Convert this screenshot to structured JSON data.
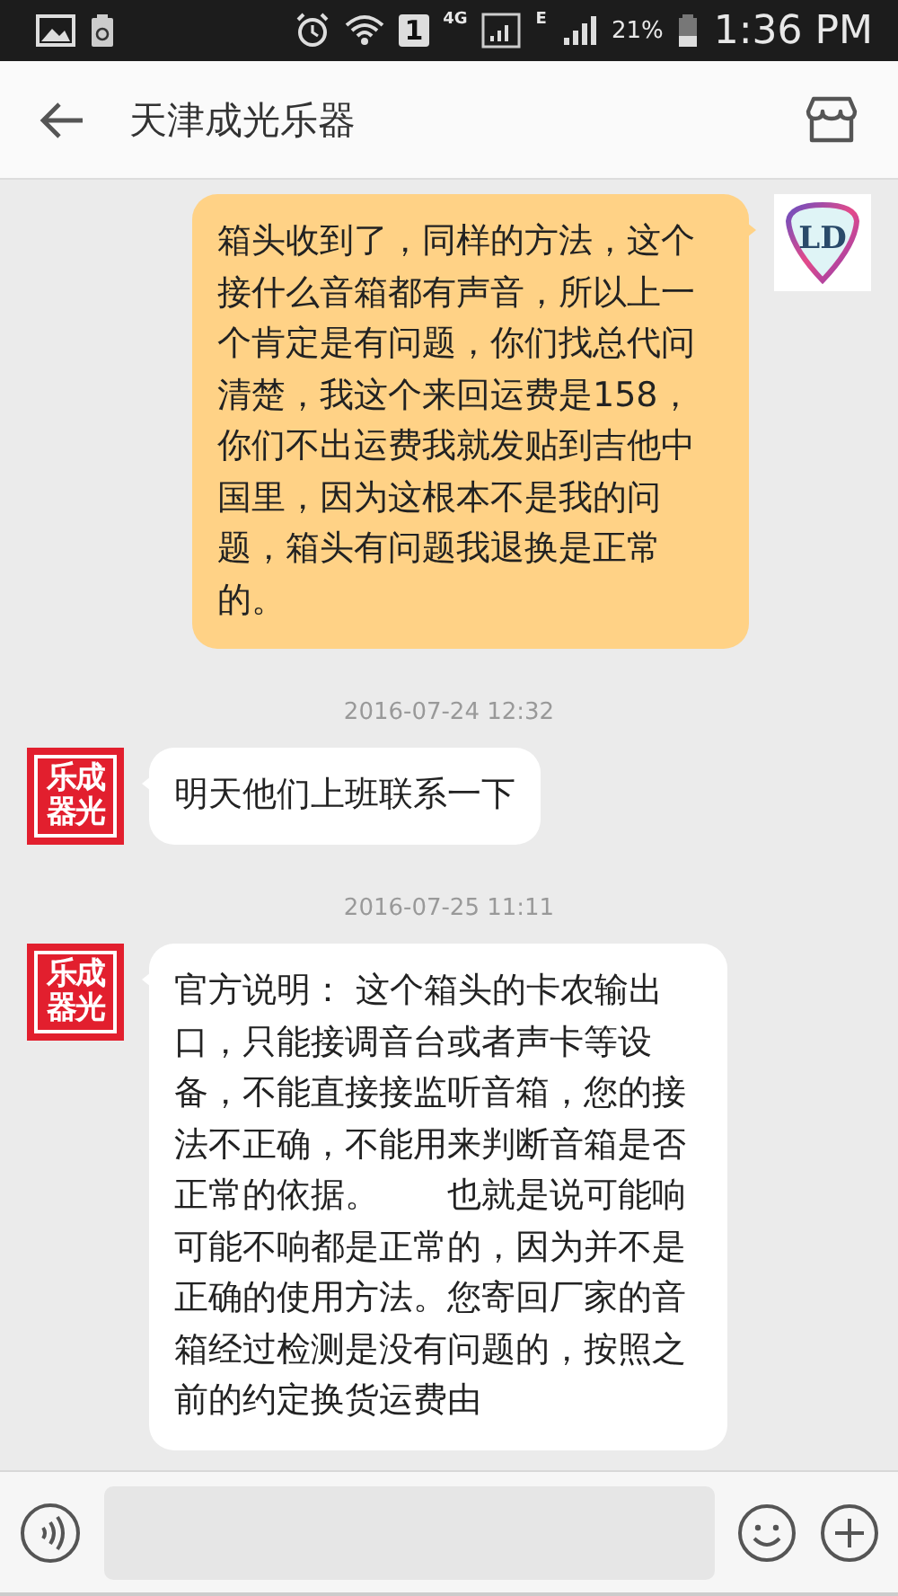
{
  "status_bar": {
    "sim": "1",
    "network_4g": "4G",
    "network_e": "E",
    "battery": "21%",
    "time": "1:36 PM"
  },
  "header": {
    "title": "天津成光乐器"
  },
  "messages": [
    {
      "kind": "sent",
      "avatar": "LD",
      "text": "箱头收到了，同样的方法，这个接什么音箱都有声音，所以上一个肯定是有问题，你们找总代问清楚，我这个来回运费是158，你们不出运费我就发贴到吉他中国里，因为这根本不是我的问题，箱头有问题我退换是正常的。"
    },
    {
      "kind": "timestamp",
      "text": "2016-07-24 12:32"
    },
    {
      "kind": "received",
      "avatar": [
        "乐成",
        "器光"
      ],
      "text": "明天他们上班联系一下"
    },
    {
      "kind": "timestamp",
      "text": "2016-07-25 11:11"
    },
    {
      "kind": "received",
      "avatar": [
        "乐成",
        "器光"
      ],
      "text": "官方说明： 这个箱头的卡农输出口，只能接调音台或者声卡等设备，不能直接接监听音箱，您的接法不正确，不能用来判断音箱是否正常的依据。　　也就是说可能响可能不响都是正常的，因为并不是正确的使用方法。您寄回厂家的音箱经过检测是没有问题的，按照之前的约定换货运费由"
    }
  ]
}
